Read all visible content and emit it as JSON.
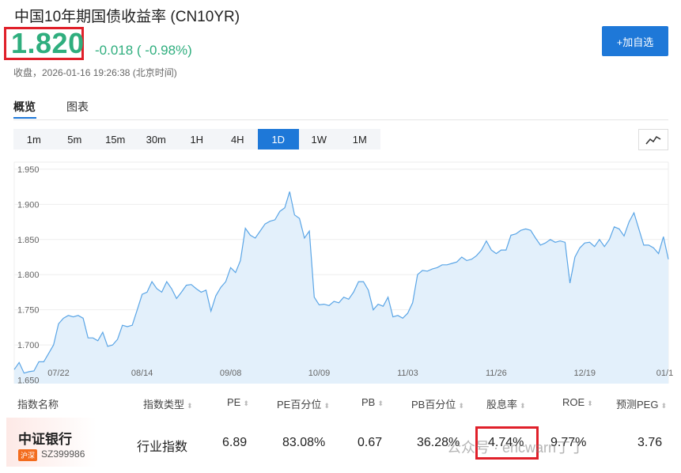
{
  "header": {
    "title": "中国10年期国债收益率 (CN10YR)",
    "price": "1.820",
    "change": "-0.018 ( -0.98%)",
    "status": "收盘，2026-01-16 19:26:38 (北京时间)",
    "add_label": "+加自选"
  },
  "tabs": [
    {
      "label": "概览",
      "active": true
    },
    {
      "label": "图表",
      "active": false
    }
  ],
  "ranges": [
    {
      "label": "1m"
    },
    {
      "label": "5m"
    },
    {
      "label": "15m"
    },
    {
      "label": "30m"
    },
    {
      "label": "1H"
    },
    {
      "label": "4H"
    },
    {
      "label": "1D",
      "active": true
    },
    {
      "label": "1W"
    },
    {
      "label": "1M"
    }
  ],
  "chart_type_icon": "line-chart-icon",
  "colors": {
    "accent": "#1e78d8",
    "up_green": "#2fae7e",
    "highlight_red": "#e0202a",
    "line": "#5aa5e6",
    "area": "#e3f0fb"
  },
  "chart_data": {
    "type": "area",
    "yticks": [
      "1.950",
      "1.900",
      "1.850",
      "1.800",
      "1.750",
      "1.700",
      "1.650"
    ],
    "ylim": [
      1.645,
      1.96
    ],
    "xticks": [
      {
        "label": "07/22",
        "i": 9
      },
      {
        "label": "08/14",
        "i": 26
      },
      {
        "label": "09/08",
        "i": 44
      },
      {
        "label": "10/09",
        "i": 62
      },
      {
        "label": "11/03",
        "i": 80
      },
      {
        "label": "11/26",
        "i": 98
      },
      {
        "label": "12/19",
        "i": 116
      },
      {
        "label": "01/1",
        "i": 134
      }
    ],
    "values": [
      1.665,
      1.675,
      1.66,
      1.662,
      1.663,
      1.676,
      1.676,
      1.688,
      1.7,
      1.73,
      1.738,
      1.742,
      1.74,
      1.742,
      1.738,
      1.71,
      1.71,
      1.706,
      1.718,
      1.698,
      1.7,
      1.708,
      1.728,
      1.726,
      1.728,
      1.75,
      1.772,
      1.775,
      1.79,
      1.78,
      1.775,
      1.79,
      1.78,
      1.766,
      1.775,
      1.785,
      1.786,
      1.78,
      1.775,
      1.778,
      1.748,
      1.77,
      1.782,
      1.79,
      1.81,
      1.803,
      1.82,
      1.866,
      1.856,
      1.852,
      1.862,
      1.872,
      1.876,
      1.878,
      1.89,
      1.895,
      1.918,
      1.885,
      1.88,
      1.852,
      1.862,
      1.768,
      1.757,
      1.758,
      1.756,
      1.762,
      1.76,
      1.768,
      1.765,
      1.775,
      1.79,
      1.79,
      1.778,
      1.75,
      1.758,
      1.755,
      1.768,
      1.74,
      1.742,
      1.738,
      1.745,
      1.76,
      1.8,
      1.806,
      1.805,
      1.808,
      1.81,
      1.814,
      1.814,
      1.816,
      1.818,
      1.825,
      1.82,
      1.822,
      1.827,
      1.835,
      1.848,
      1.835,
      1.83,
      1.835,
      1.835,
      1.856,
      1.858,
      1.863,
      1.865,
      1.863,
      1.852,
      1.842,
      1.845,
      1.85,
      1.846,
      1.848,
      1.846,
      1.788,
      1.825,
      1.838,
      1.845,
      1.846,
      1.84,
      1.85,
      1.84,
      1.85,
      1.868,
      1.865,
      1.855,
      1.875,
      1.888,
      1.865,
      1.842,
      1.842,
      1.838,
      1.83,
      1.854,
      1.822
    ]
  },
  "table": {
    "headers": [
      "指数名称",
      "指数类型",
      "PE",
      "PE百分位",
      "PB",
      "PB百分位",
      "股息率",
      "ROE",
      "预测PEG"
    ],
    "row": {
      "name": "中证银行",
      "badge": "沪深",
      "code": "SZ399986",
      "type": "行业指数",
      "pe": "6.89",
      "pe_pct": "83.08%",
      "pb": "0.67",
      "pb_pct": "36.28%",
      "dividend": "4.74%",
      "roe": "9.77%",
      "peg": "3.76"
    }
  },
  "watermark": "公众号 · ericwarn丁丁"
}
